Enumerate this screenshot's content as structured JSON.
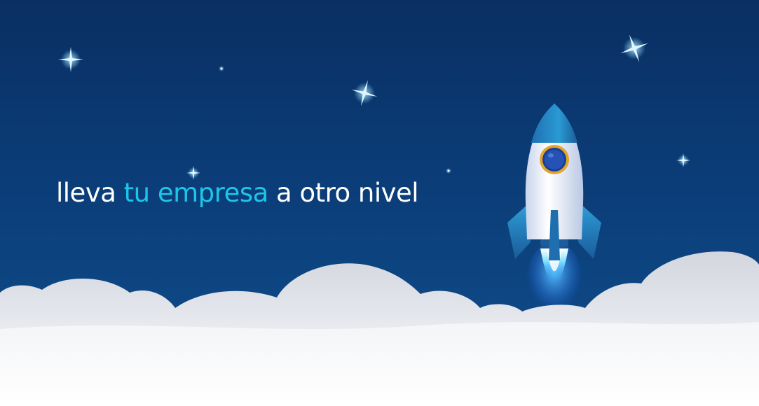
{
  "headline": {
    "part1": "lleva ",
    "accent": "tu empresa",
    "part2": " a otro nivel"
  },
  "colors": {
    "background_top": "#0a2f63",
    "background_bottom": "#0f4f8d",
    "text": "#ffffff",
    "accent": "#1cc6e8",
    "cloud": "#eef0f4"
  },
  "icons": [
    "sparkle-star-icon",
    "rocket-icon",
    "cloud-shape"
  ]
}
